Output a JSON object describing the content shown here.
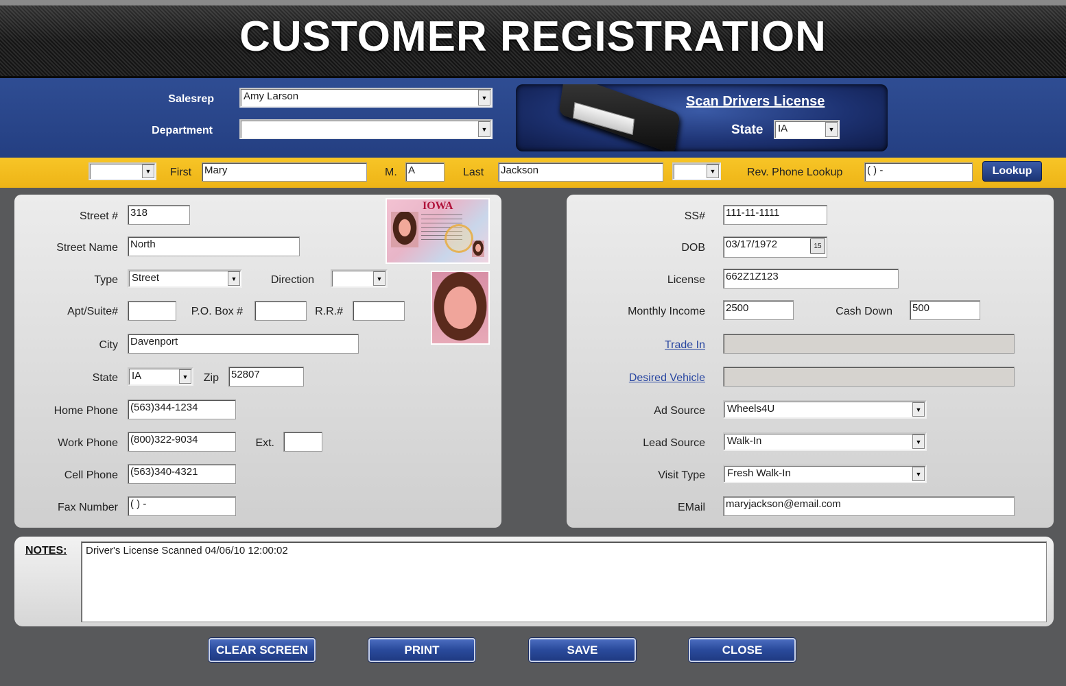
{
  "header": {
    "title": "CUSTOMER REGISTRATION"
  },
  "top": {
    "salesrep_label": "Salesrep",
    "salesrep_value": "Amy Larson",
    "department_label": "Department",
    "department_value": "",
    "scan_link": "Scan Drivers License",
    "scan_state_label": "State",
    "scan_state_value": "IA"
  },
  "name_bar": {
    "prefix_value": "",
    "first_label": "First",
    "first_value": "Mary",
    "middle_label": "M.",
    "middle_value": "A",
    "last_label": "Last",
    "last_value": "Jackson",
    "suffix_value": "",
    "rev_phone_label": "Rev. Phone Lookup",
    "rev_phone_value": "(   )   -",
    "lookup_button": "Lookup"
  },
  "address": {
    "street_num_label": "Street #",
    "street_num_value": "318",
    "street_name_label": "Street Name",
    "street_name_value": "North",
    "type_label": "Type",
    "type_value": "Street",
    "direction_label": "Direction",
    "direction_value": "",
    "apt_label": "Apt/Suite#",
    "apt_value": "",
    "pobox_label": "P.O. Box #",
    "pobox_value": "",
    "rr_label": "R.R.#",
    "rr_value": "",
    "city_label": "City",
    "city_value": "Davenport",
    "state_label": "State",
    "state_value": "IA",
    "zip_label": "Zip",
    "zip_value": "52807",
    "home_phone_label": "Home Phone",
    "home_phone_value": "(563)344-1234",
    "work_phone_label": "Work Phone",
    "work_phone_value": "(800)322-9034",
    "ext_label": "Ext.",
    "ext_value": "",
    "cell_phone_label": "Cell Phone",
    "cell_phone_value": "(563)340-4321",
    "fax_label": "Fax Number",
    "fax_value": "(   )   -",
    "license_card_state": "IOWA"
  },
  "details": {
    "ss_label": "SS#",
    "ss_value": "111-11-1111",
    "dob_label": "DOB",
    "dob_value": "03/17/1972",
    "calendar_glyph": "15",
    "license_label": "License",
    "license_value": "662Z1Z123",
    "income_label": "Monthly Income",
    "income_value": "2500",
    "cash_down_label": "Cash Down",
    "cash_down_value": "500",
    "trade_in_label": "Trade In",
    "trade_in_value": "",
    "desired_vehicle_label": "Desired Vehicle",
    "desired_vehicle_value": "",
    "ad_source_label": "Ad Source",
    "ad_source_value": "Wheels4U",
    "lead_source_label": "Lead Source",
    "lead_source_value": "Walk-In",
    "visit_type_label": "Visit Type",
    "visit_type_value": "Fresh Walk-In",
    "email_label": "EMail",
    "email_value": "maryjackson@email.com"
  },
  "notes": {
    "label": "NOTES:",
    "value": "Driver's License Scanned 04/06/10  12:00:02"
  },
  "buttons": {
    "clear": "CLEAR SCREEN",
    "print": "PRINT",
    "save": "SAVE",
    "close": "CLOSE"
  },
  "colors": {
    "blue_band": "#2a4589",
    "yellow_band": "#f2bc1e",
    "panel": "#dedede",
    "button_blue": "#2a4a9b"
  }
}
